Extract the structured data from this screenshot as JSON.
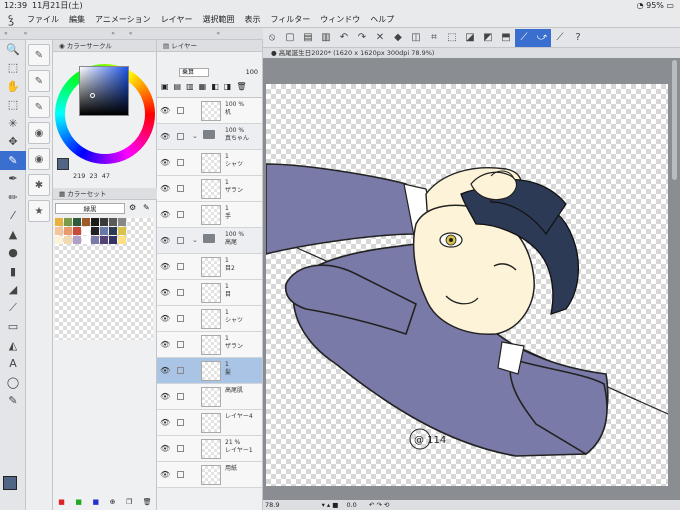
{
  "status_bar": {
    "time": "12:39",
    "date": "11月21日(土)",
    "battery": "95%"
  },
  "menu": {
    "logo": "ꝣ",
    "items": [
      "ファイル",
      "編集",
      "アニメーション",
      "レイヤー",
      "選択範囲",
      "表示",
      "フィルター",
      "ウィンドウ",
      "ヘルプ"
    ]
  },
  "tools": [
    "🔍",
    "⬚",
    "✋",
    "⬚",
    "✳",
    "✥",
    "✎",
    "✒",
    "✏",
    "⁄",
    "▲",
    "●",
    "▮",
    "◢",
    "⟋",
    "▭",
    "◭",
    "A",
    "◯",
    "✎"
  ],
  "subtools": [
    "✎",
    "✎",
    "✎",
    "◉",
    "◉",
    "✱",
    "★"
  ],
  "color_panel": {
    "title": "カラーサークル",
    "h": "219",
    "s": "23",
    "v": "47",
    "set_title": "カラーセット",
    "set_name": "緑黒"
  },
  "layer_panel": {
    "title": "レイヤー",
    "blend": "乗算",
    "opacity": "100",
    "layers": [
      {
        "opacity": "100 %",
        "name": "机",
        "kind": "layer"
      },
      {
        "opacity": "100 %",
        "name": "真ちゃん",
        "kind": "folder"
      },
      {
        "opacity": "1",
        "name": "シャツ",
        "kind": "layer"
      },
      {
        "opacity": "1",
        "name": "ザラン",
        "kind": "layer"
      },
      {
        "opacity": "1",
        "name": "手",
        "kind": "layer"
      },
      {
        "opacity": "100 %",
        "name": "高尾",
        "kind": "folder"
      },
      {
        "opacity": "1",
        "name": "目2",
        "kind": "layer"
      },
      {
        "opacity": "1",
        "name": "目",
        "kind": "layer"
      },
      {
        "opacity": "1",
        "name": "シャツ",
        "kind": "layer"
      },
      {
        "opacity": "1",
        "name": "ザラン",
        "kind": "layer"
      },
      {
        "opacity": "1",
        "name": "髪",
        "kind": "layer",
        "selected": true
      },
      {
        "opacity": "",
        "name": "高尾肌",
        "kind": "layer"
      },
      {
        "opacity": "",
        "name": "レイヤー4",
        "kind": "layer"
      },
      {
        "opacity": "21 %",
        "name": "レイヤー1",
        "kind": "layer"
      },
      {
        "opacity": "",
        "name": "用紙",
        "kind": "layer"
      }
    ]
  },
  "document": {
    "tab": "高尾誕生日2020* (1620 x 1620px 300dpi 78.9%)",
    "zoom": "78.9",
    "rotation": "0.0",
    "signature": "@ 114"
  },
  "colors": {
    "accent": "#3a6fd0",
    "jacket": "#7a7aa8",
    "hair": "#2d3a55",
    "skin": "#fdf3d8",
    "current_color": "#516584"
  }
}
